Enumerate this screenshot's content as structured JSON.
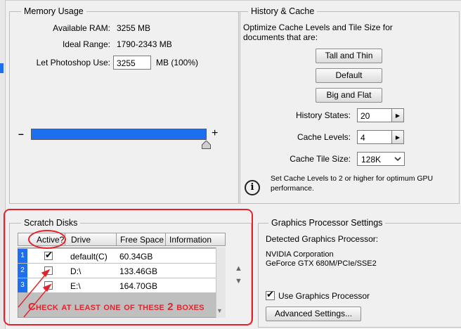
{
  "memory": {
    "title": "Memory Usage",
    "available_label": "Available RAM:",
    "available_value": "3255 MB",
    "ideal_label": "Ideal Range:",
    "ideal_value": "1790-2343 MB",
    "let_label": "Let Photoshop Use:",
    "let_value": "3255",
    "let_unit": "MB (100%)",
    "minus": "–",
    "plus": "+",
    "slider_fraction": 1.0
  },
  "history": {
    "title": "History & Cache",
    "description": "Optimize Cache Levels and Tile Size for documents that are:",
    "btn_tall": "Tall and Thin",
    "btn_default": "Default",
    "btn_big": "Big and Flat",
    "states_label": "History States:",
    "states_value": "20",
    "levels_label": "Cache Levels:",
    "levels_value": "4",
    "tile_label": "Cache Tile Size:",
    "tile_value": "128K",
    "info_icon": "i",
    "info_text": "Set Cache Levels to 2 or higher for optimum GPU performance."
  },
  "scratch": {
    "title": "Scratch Disks",
    "columns": [
      "Active?",
      "Drive",
      "Free Space",
      "Information"
    ],
    "rows": [
      {
        "num": "1",
        "drive": "default(C)",
        "free": "60.34GB",
        "info": "",
        "active": true
      },
      {
        "num": "2",
        "drive": "D:\\",
        "free": "133.46GB",
        "info": "",
        "active": false
      },
      {
        "num": "3",
        "drive": "E:\\",
        "free": "164.70GB",
        "info": "",
        "active": false
      }
    ],
    "annotation": "Check at least one of these 2 boxes"
  },
  "gpu": {
    "title": "Graphics Processor Settings",
    "detected_label": "Detected Graphics Processor:",
    "vendor": "NVIDIA Corporation",
    "model": "GeForce GTX 680M/PCIe/SSE2",
    "use_label": "Use Graphics Processor",
    "use_checked": true,
    "advanced_label": "Advanced Settings..."
  },
  "colors": {
    "accent_blue": "#1e6ff0",
    "annotation_red": "#e3232c"
  }
}
